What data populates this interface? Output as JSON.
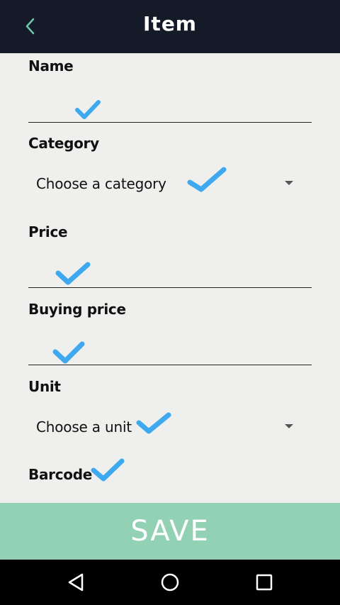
{
  "appbar": {
    "title": "Item",
    "back_icon": "chevron-left-icon",
    "accent_color": "#6fc8a8",
    "background": "#151a28"
  },
  "form": {
    "name": {
      "label": "Name",
      "value": ""
    },
    "category": {
      "label": "Category",
      "selected": "Choose a category"
    },
    "price": {
      "label": "Price",
      "value": ""
    },
    "buying_price": {
      "label": "Buying price",
      "value": ""
    },
    "unit": {
      "label": "Unit",
      "selected": "Choose a unit"
    },
    "barcode": {
      "label": "Barcode"
    }
  },
  "save_button": {
    "label": "SAVE",
    "color": "#93d1b4"
  },
  "navbar": {
    "back_icon": "triangle-back-icon",
    "home_icon": "circle-home-icon",
    "recents_icon": "square-recents-icon"
  },
  "check_color": "#3fa9f0"
}
